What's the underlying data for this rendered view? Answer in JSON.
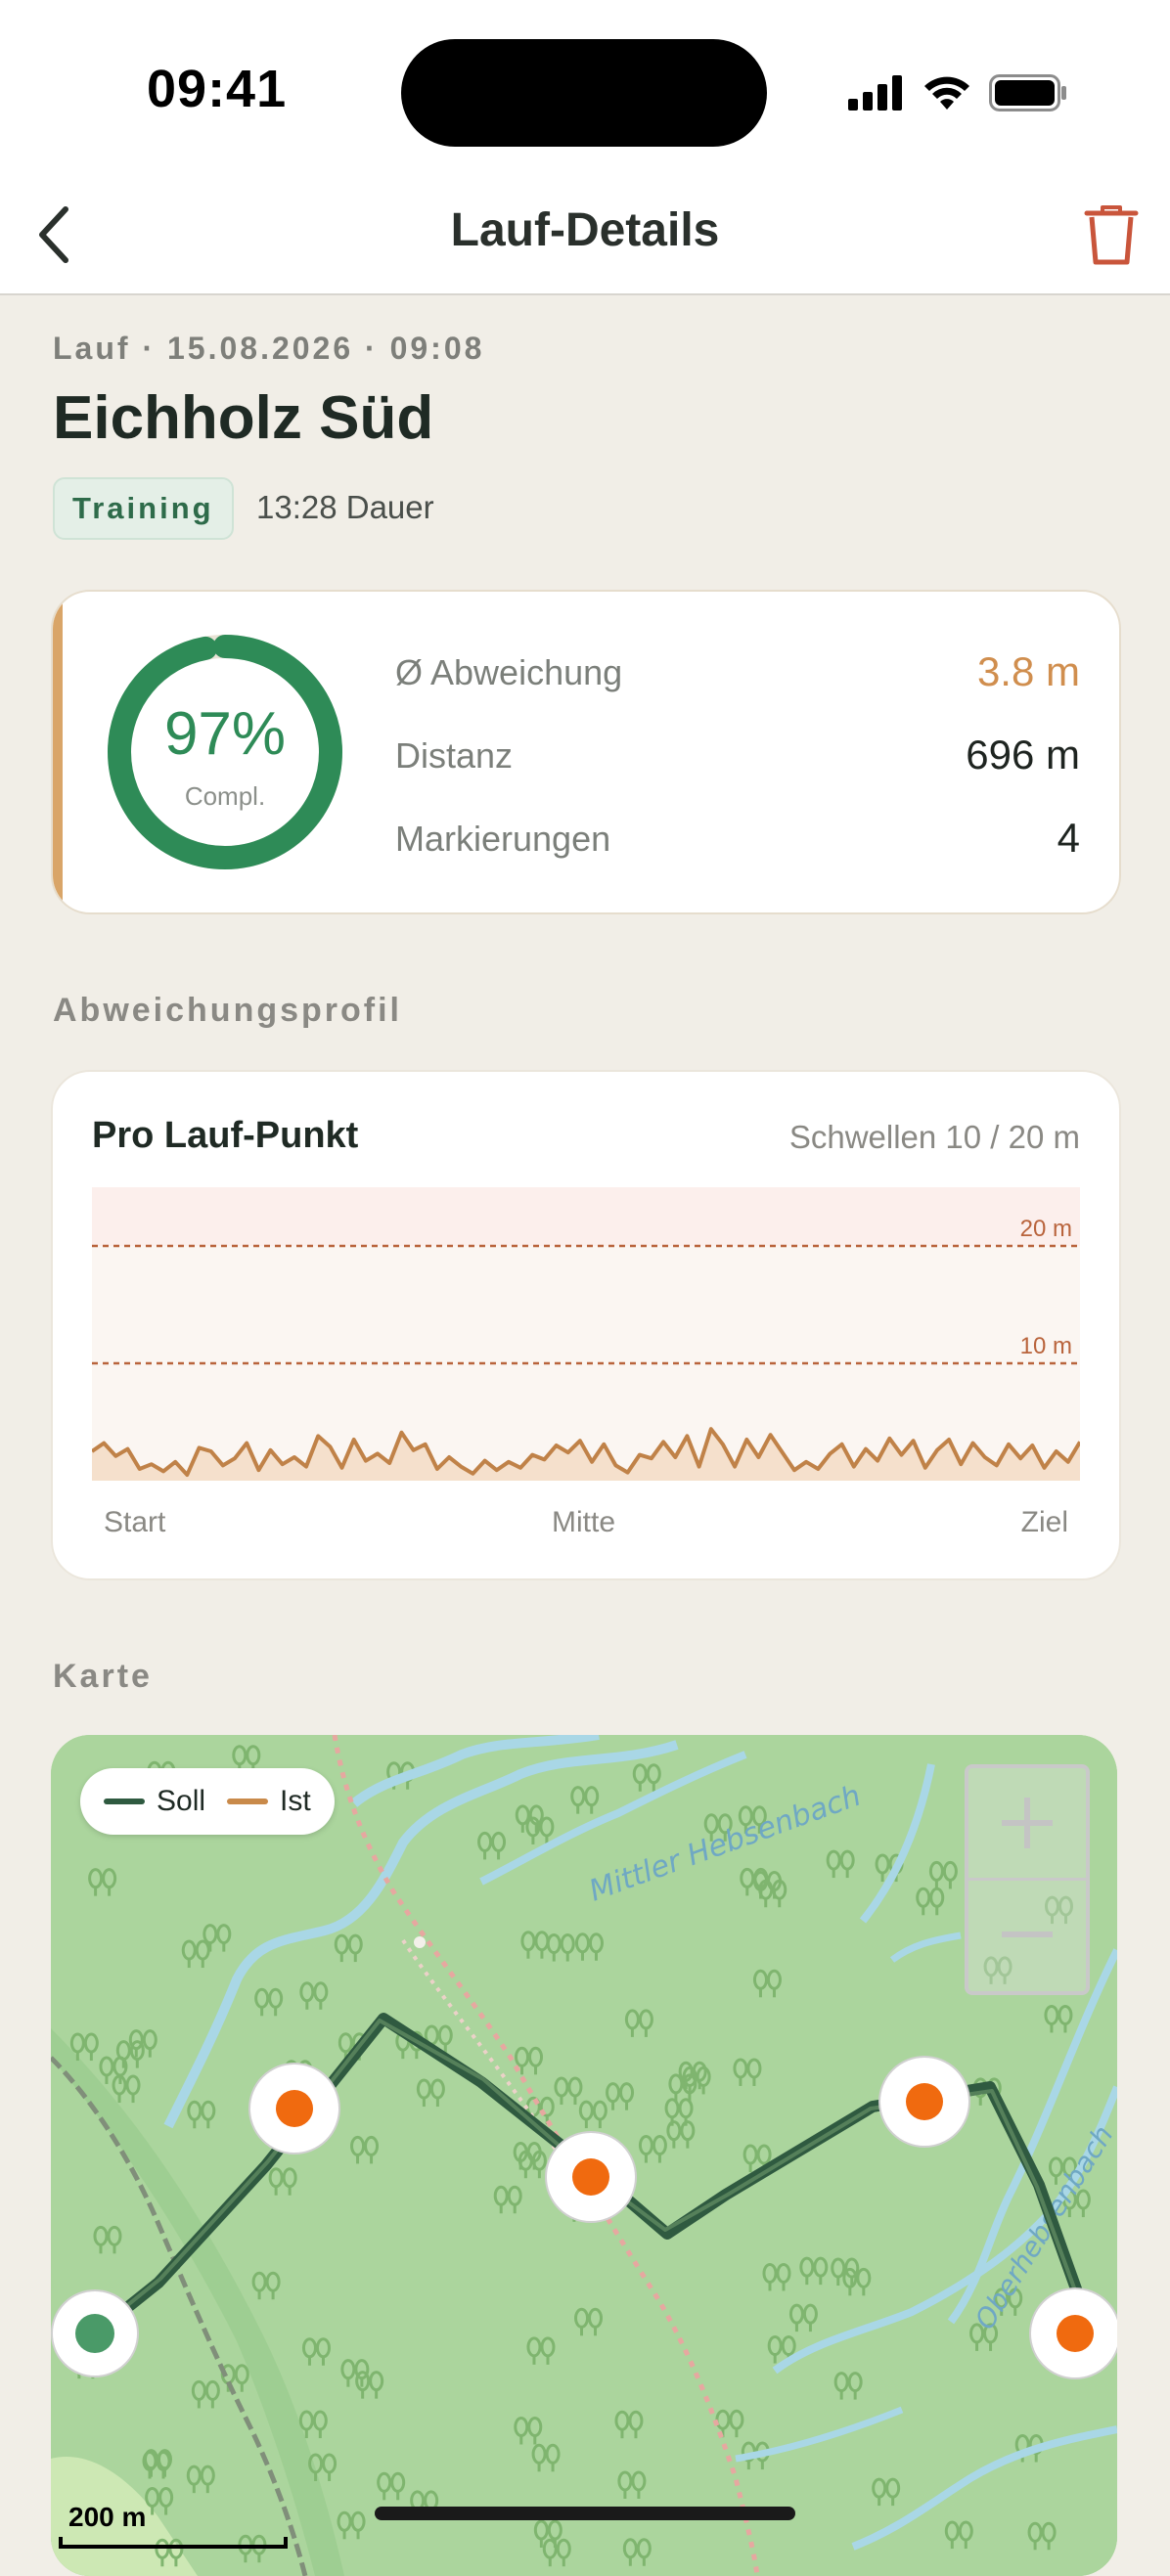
{
  "status_bar": {
    "time": "09:41"
  },
  "nav": {
    "title": "Lauf-Details"
  },
  "run": {
    "meta": "Lauf · 15.08.2026 · 09:08",
    "title": "Eichholz Süd",
    "badge": "Training",
    "duration": "13:28 Dauer"
  },
  "summary": {
    "completion_percent": 97,
    "completion_label": "97%",
    "completion_caption": "Compl.",
    "stats": [
      {
        "label": "Ø Abweichung",
        "value": "3.8 m"
      },
      {
        "label": "Distanz",
        "value": "696 m"
      },
      {
        "label": "Markierungen",
        "value": "4"
      }
    ]
  },
  "profile_section": "Abweichungsprofil",
  "profile": {
    "title": "Pro Lauf-Punkt",
    "thresholds_text": "Schwellen 10 / 20 m",
    "axis": {
      "start": "Start",
      "mid": "Mitte",
      "end": "Ziel"
    }
  },
  "chart_data": {
    "type": "area",
    "title": "Pro Lauf-Punkt",
    "ylim": [
      0,
      25
    ],
    "thresholds": [
      {
        "value": 20,
        "label": "20 m"
      },
      {
        "value": 10,
        "label": "10 m"
      }
    ],
    "x_labels": [
      "Start",
      "Mitte",
      "Ziel"
    ],
    "values": [
      2.5,
      3.2,
      2.1,
      2.7,
      1.0,
      1.4,
      0.8,
      1.6,
      0.5,
      2.8,
      2.5,
      1.3,
      1.9,
      3.2,
      0.9,
      2.6,
      1.4,
      2.0,
      1.2,
      3.8,
      2.9,
      1.1,
      3.5,
      1.7,
      2.3,
      1.5,
      4.1,
      2.6,
      3.1,
      1.0,
      2.0,
      1.2,
      0.6,
      1.7,
      0.9,
      1.6,
      1.1,
      2.2,
      1.8,
      3.0,
      2.4,
      3.4,
      1.6,
      3.1,
      1.3,
      0.7,
      2.2,
      1.9,
      3.3,
      2.0,
      3.8,
      1.2,
      4.4,
      3.1,
      1.2,
      3.5,
      2.0,
      3.9,
      2.4,
      0.9,
      1.6,
      1.0,
      2.3,
      3.1,
      1.2,
      2.7,
      1.7,
      3.6,
      2.2,
      3.4,
      1.1,
      2.6,
      3.5,
      1.4,
      3.2,
      2.0,
      1.3,
      3.1,
      1.9,
      3.0,
      1.1,
      2.5,
      1.6,
      3.3
    ]
  },
  "map_section": "Karte",
  "map": {
    "legend": [
      {
        "label": "Soll",
        "color": "#2f5a40"
      },
      {
        "label": "Ist",
        "color": "#c98a4a"
      }
    ],
    "labels": {
      "creek1": "Mittler Hebsenbach",
      "creek2": "Oberhebsenbach"
    },
    "scale": "200 m"
  },
  "colors": {
    "accent": "#d08e4e",
    "success": "#2e8b57",
    "danger": "#c9553b",
    "checkpoint": "#f06a0f"
  }
}
